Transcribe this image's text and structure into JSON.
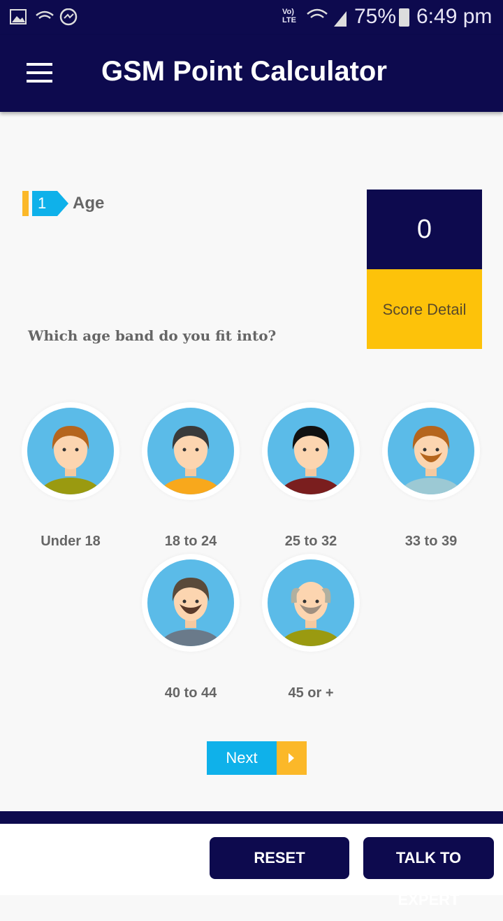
{
  "status_bar": {
    "battery": "75%",
    "time": "6:49 pm",
    "network": "LTE"
  },
  "header": {
    "title": "GSM Point Calculator"
  },
  "step": {
    "number": "1",
    "label": "Age"
  },
  "score": {
    "value": "0",
    "detail_label": "Score Detail"
  },
  "question": "Which age band do you fit into?",
  "options": [
    {
      "label": "Under 18",
      "hair": "#b5651d",
      "shirt": "#9a9a10",
      "beard": ""
    },
    {
      "label": "18 to 24",
      "hair": "#3a3a3a",
      "shirt": "#f8a81c",
      "beard": ""
    },
    {
      "label": "25 to 32",
      "hair": "#111111",
      "shirt": "#7a1e1e",
      "beard": ""
    },
    {
      "label": "33 to 39",
      "hair": "#b5651d",
      "shirt": "#9cc9d4",
      "beard": "#b5651d"
    },
    {
      "label": "40 to 44",
      "hair": "#5a4a3a",
      "shirt": "#6a7a8a",
      "beard": "#5a3a2a"
    },
    {
      "label": "45 or +",
      "hair": "#b0b0a0",
      "shirt": "#9a9a10",
      "beard": "#a09080"
    }
  ],
  "next_label": "Next",
  "footer": {
    "reset": "RESET",
    "expert": "TALK TO EXPERT"
  }
}
